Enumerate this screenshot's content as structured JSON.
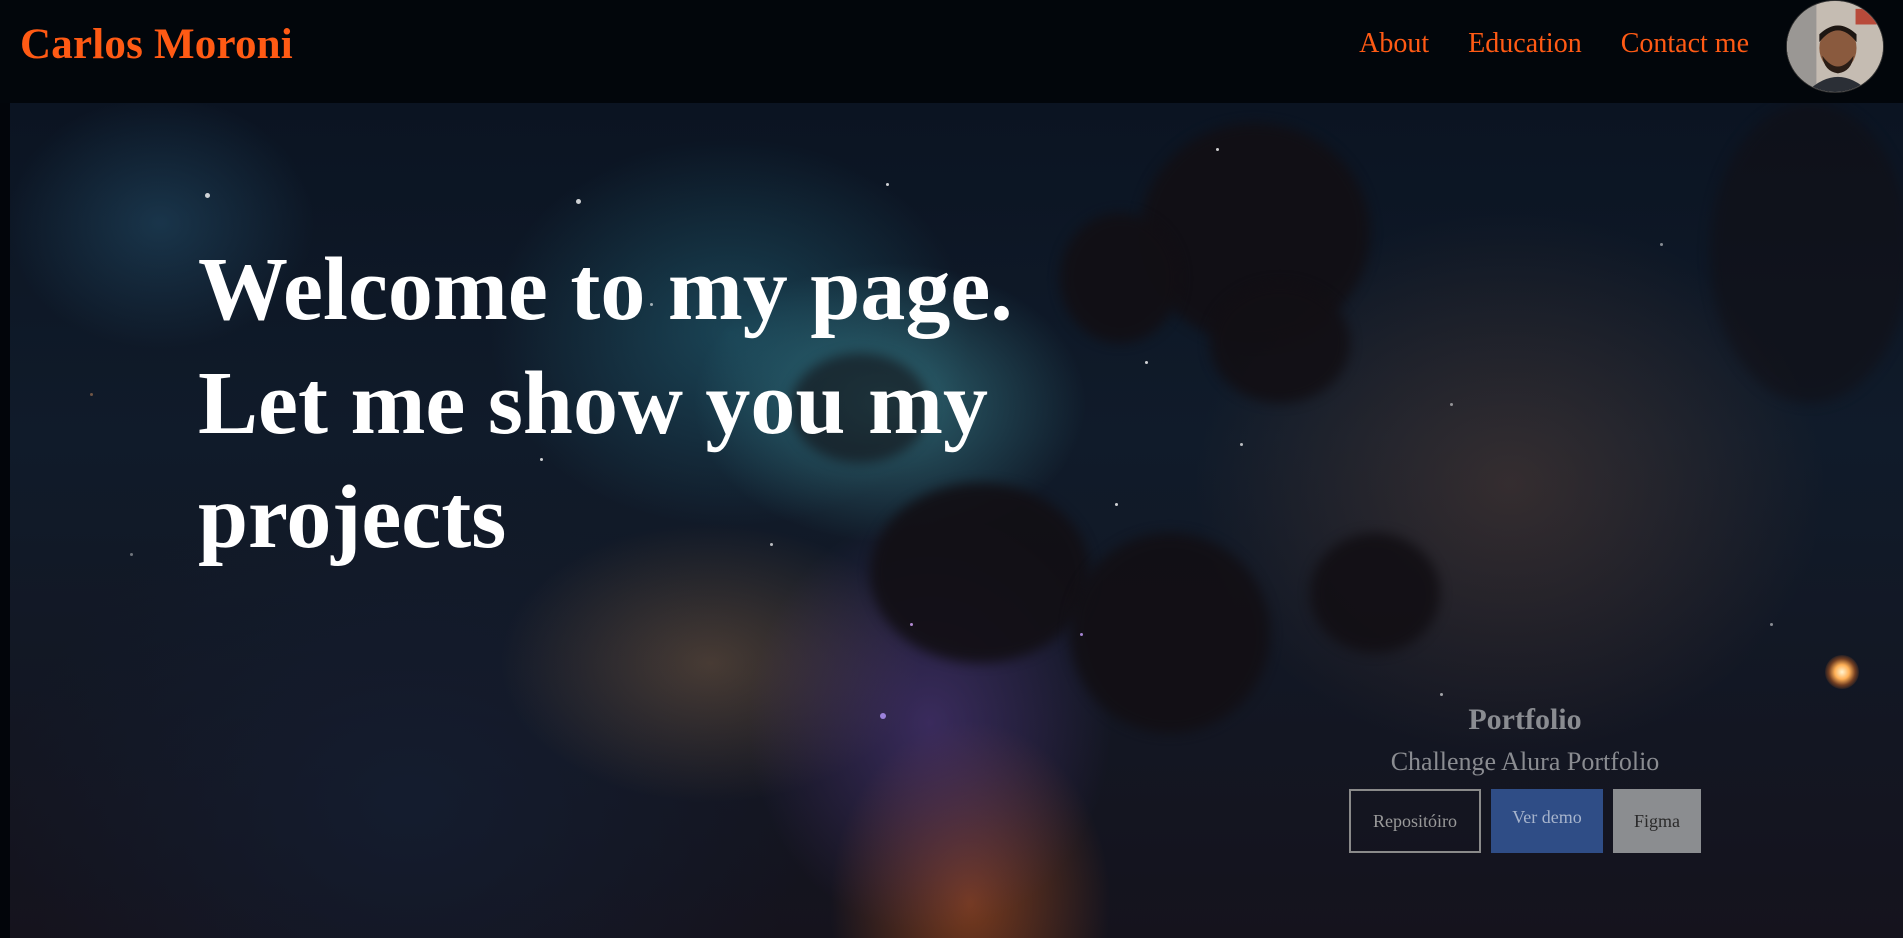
{
  "header": {
    "brand": "Carlos Moroni",
    "nav": [
      "About",
      "Education",
      "Contact me"
    ],
    "avatar_icon": "profile-photo"
  },
  "hero": {
    "headline_line1": "Welcome to my page.",
    "headline_line2": "Let me show you my",
    "headline_line3": "projects",
    "background_icon": "nebula-space-image"
  },
  "portfolio_card": {
    "title": "Portfolio",
    "subtitle": "Challenge Alura Portfolio",
    "buttons": {
      "repo": "Repositóiro",
      "demo": "Ver demo",
      "figma": "Figma"
    }
  },
  "colors": {
    "accent": "#ff5a14",
    "header_bg": "#02060b",
    "demo_button": "#2f4d86",
    "figma_button": "#8b8d90"
  }
}
